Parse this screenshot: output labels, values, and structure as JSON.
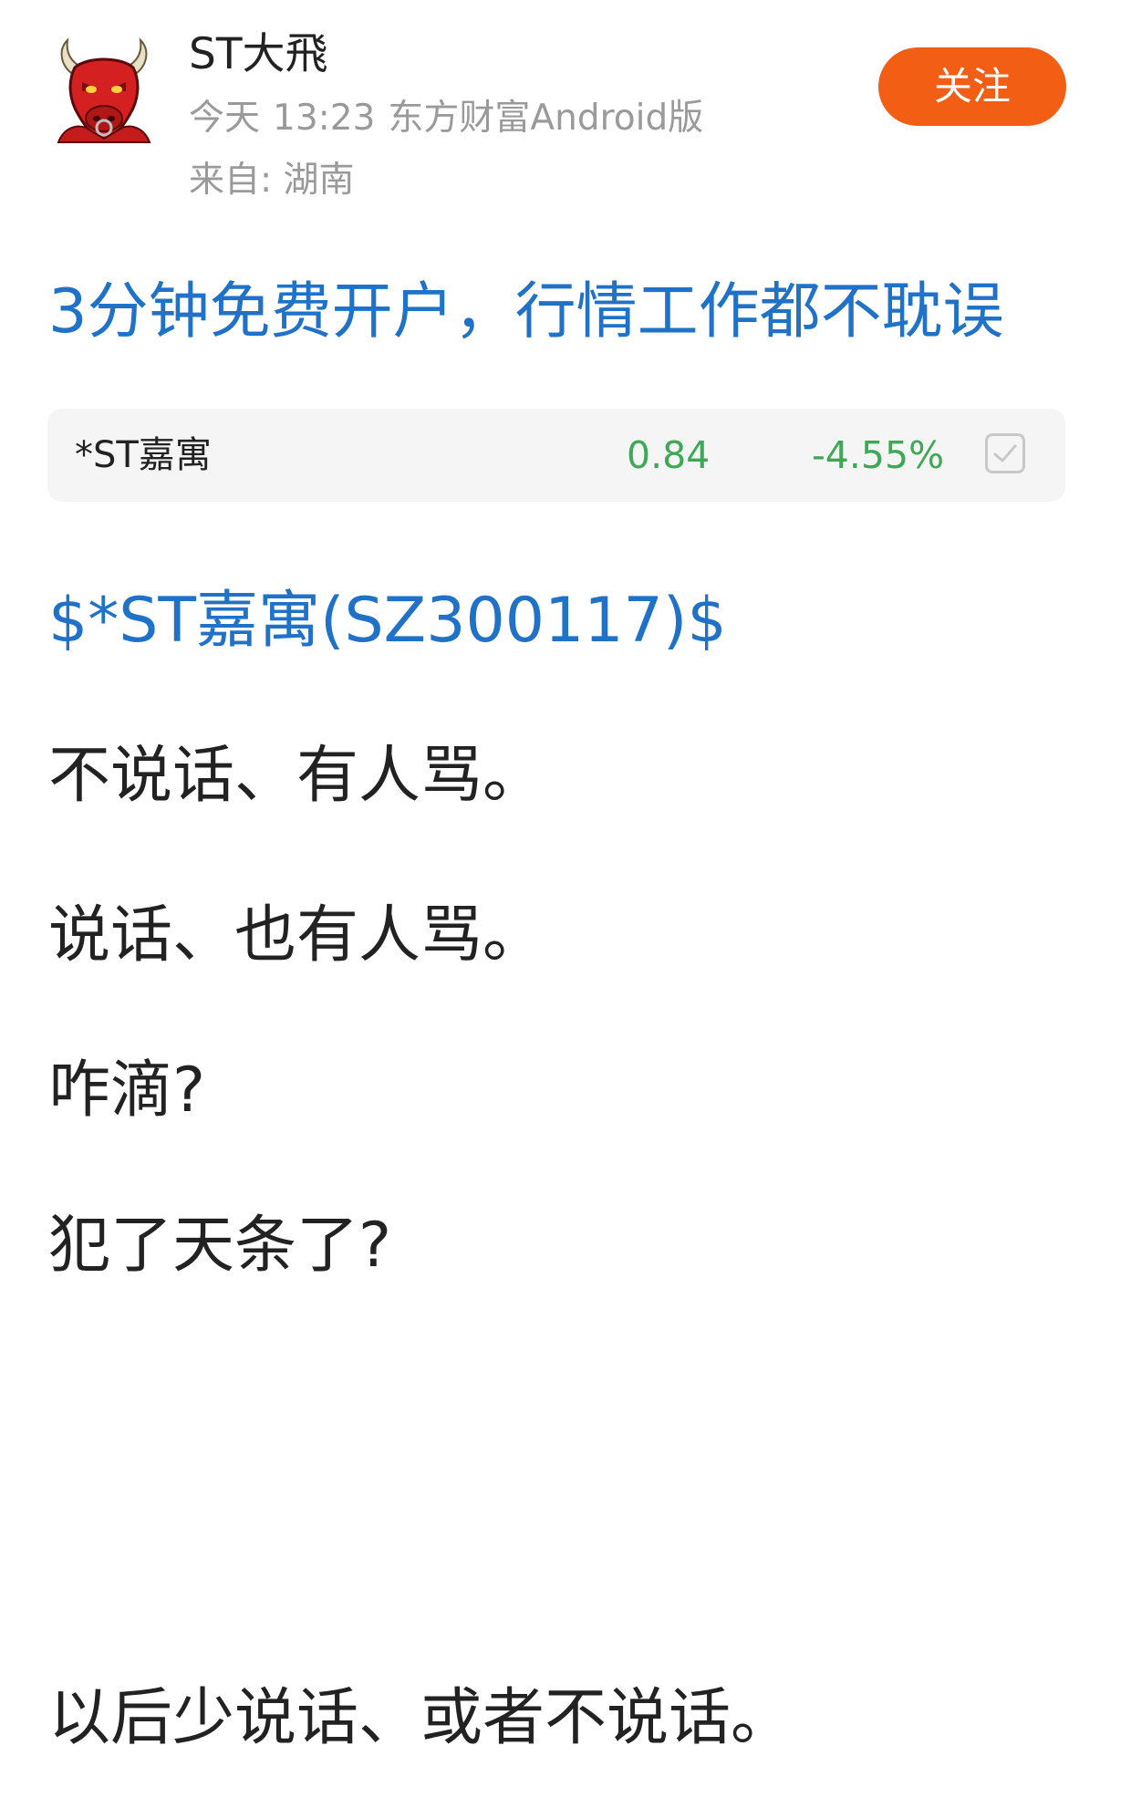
{
  "author": {
    "name": "ST大飛",
    "avatar_icon": "red-bull-avatar-icon"
  },
  "post_meta": {
    "date": "今天",
    "time": "13:23",
    "source": "东方财富Android版",
    "location": "来自: 湖南"
  },
  "follow_button": {
    "label": "关注",
    "color": "#f25f14"
  },
  "promo": {
    "text": "3分钟免费开户，行情工作都不耽误",
    "color": "#1f72c7"
  },
  "stock_card": {
    "name": "*ST嘉寓",
    "price": "0.84",
    "change": "-4.55%",
    "change_color": "#3da855",
    "checkbox_icon": "checkbox-icon"
  },
  "post": {
    "stock_tag": "$*ST嘉寓(SZ300117)$",
    "lines": [
      "不说话、有人骂。",
      "说话、也有人骂。",
      "咋滴?",
      "犯了天条了?",
      "以后少说话、或者不说话。"
    ]
  }
}
